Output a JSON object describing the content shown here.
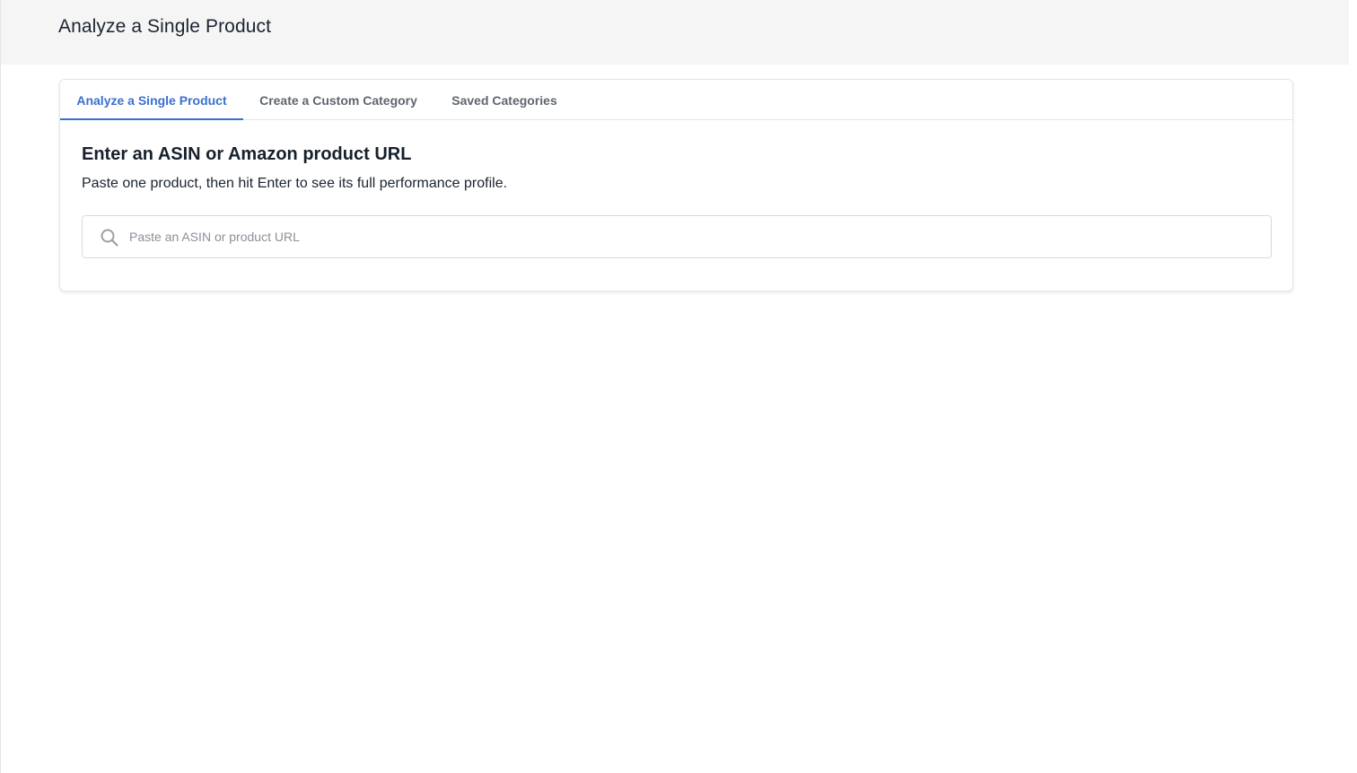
{
  "header": {
    "title": "Analyze a Single Product"
  },
  "tabs": [
    {
      "label": "Analyze a Single Product",
      "active": true
    },
    {
      "label": "Create a Custom Category",
      "active": false
    },
    {
      "label": "Saved Categories",
      "active": false
    }
  ],
  "main": {
    "heading": "Enter an ASIN or Amazon product URL",
    "subheading": "Paste one product, then hit Enter to see its full performance profile.",
    "search": {
      "placeholder": "Paste an ASIN or product URL",
      "value": "",
      "icon": "search-icon"
    }
  },
  "colors": {
    "accent": "#3a6fd0",
    "header_bg": "#f5f5f5",
    "text": "#1b2430"
  }
}
